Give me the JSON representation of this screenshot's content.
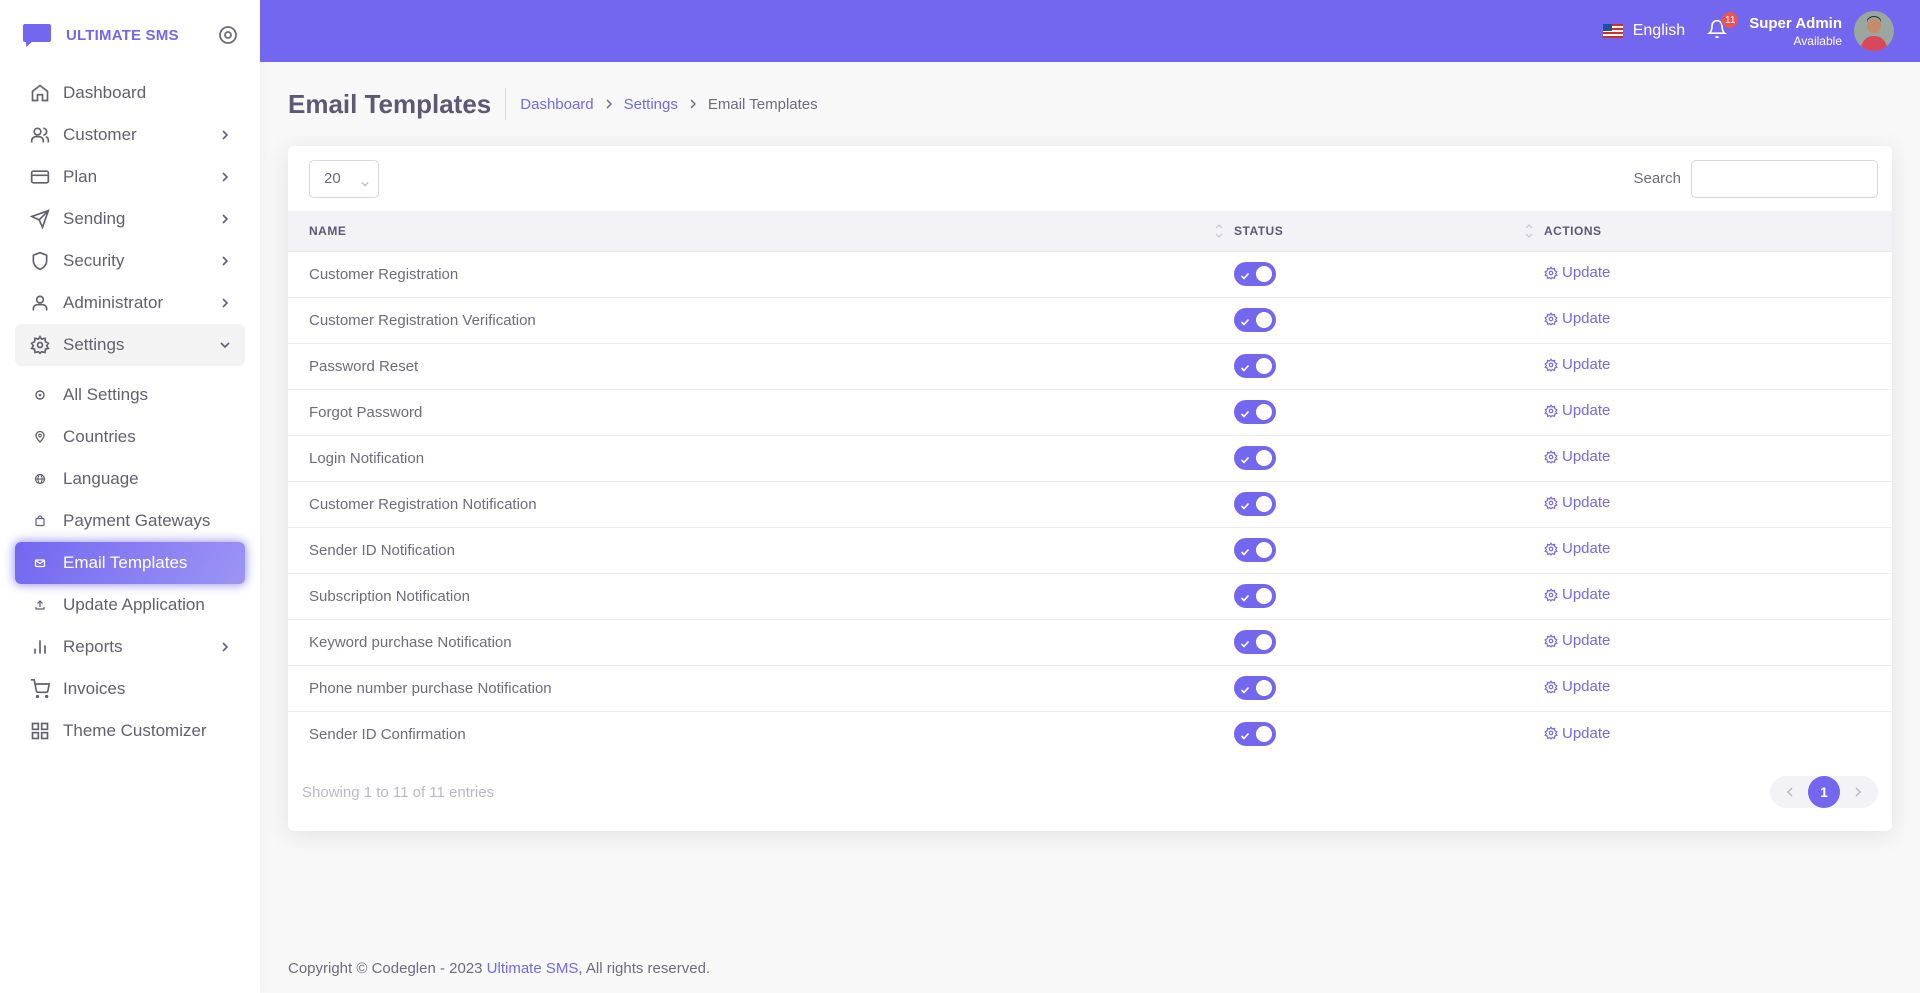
{
  "brand": {
    "name": "ULTIMATE SMS",
    "icon": "message-logo-icon",
    "accent": "#7367f0"
  },
  "sidebar": {
    "items": [
      {
        "label": "Dashboard",
        "icon": "home-icon"
      },
      {
        "label": "Customer",
        "icon": "users-icon"
      },
      {
        "label": "Plan",
        "icon": "credit-card-icon"
      },
      {
        "label": "Sending",
        "icon": "send-icon"
      },
      {
        "label": "Security",
        "icon": "shield-icon"
      },
      {
        "label": "Administrator",
        "icon": "user-icon"
      },
      {
        "label": "Settings",
        "icon": "gear-icon"
      },
      {
        "label": "All Settings",
        "icon": "circle-icon"
      },
      {
        "label": "Countries",
        "icon": "map-pin-icon"
      },
      {
        "label": "Language",
        "icon": "globe-icon"
      },
      {
        "label": "Payment Gateways",
        "icon": "shopping-bag-icon"
      },
      {
        "label": "Email Templates",
        "icon": "mail-icon"
      },
      {
        "label": "Update Application",
        "icon": "upload-icon"
      },
      {
        "label": "Reports",
        "icon": "bar-chart-icon"
      },
      {
        "label": "Invoices",
        "icon": "shopping-cart-icon"
      },
      {
        "label": "Theme Customizer",
        "icon": "grid-icon"
      }
    ]
  },
  "header": {
    "language": "English",
    "notifications_count": "11",
    "user_name": "Super Admin",
    "user_status": "Available"
  },
  "page": {
    "title": "Email Templates",
    "breadcrumb": [
      "Dashboard",
      "Settings",
      "Email Templates"
    ]
  },
  "table": {
    "page_length": "20",
    "search_label": "Search",
    "search_placeholder": "",
    "columns": [
      "NAME",
      "STATUS",
      "ACTIONS"
    ],
    "action_label": "Update",
    "rows": [
      {
        "name": "Customer Registration",
        "enabled": true
      },
      {
        "name": "Customer Registration Verification",
        "enabled": true
      },
      {
        "name": "Password Reset",
        "enabled": true
      },
      {
        "name": "Forgot Password",
        "enabled": true
      },
      {
        "name": "Login Notification",
        "enabled": true
      },
      {
        "name": "Customer Registration Notification",
        "enabled": true
      },
      {
        "name": "Sender ID Notification",
        "enabled": true
      },
      {
        "name": "Subscription Notification",
        "enabled": true
      },
      {
        "name": "Keyword purchase Notification",
        "enabled": true
      },
      {
        "name": "Phone number purchase Notification",
        "enabled": true
      },
      {
        "name": "Sender ID Confirmation",
        "enabled": true
      }
    ],
    "info": "Showing 1 to 11 of 11 entries",
    "current_page": "1"
  },
  "footer": {
    "prefix": "Copyright © Codeglen - 2023 ",
    "link": "Ultimate SMS",
    "suffix": ", All rights reserved."
  }
}
